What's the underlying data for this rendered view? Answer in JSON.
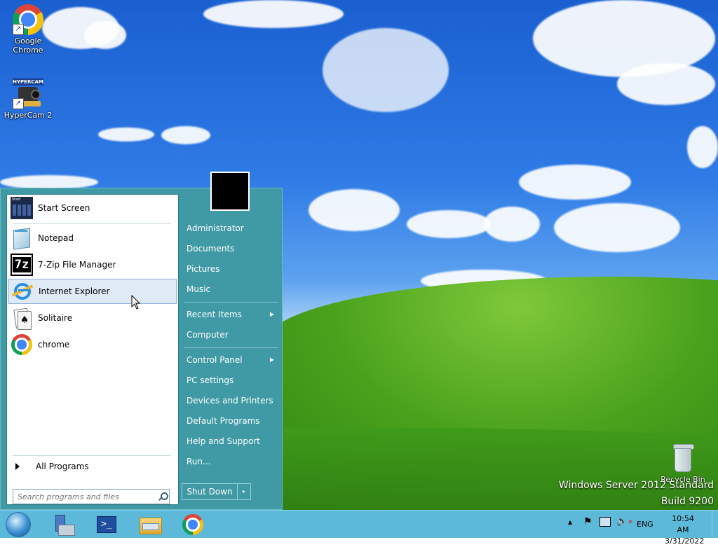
{
  "desktop": {
    "icons": [
      {
        "label": "Google Chrome",
        "icon": "chrome-icon"
      },
      {
        "label": "HyperCam 2",
        "icon": "hypercam-icon"
      },
      {
        "label": "Recycle Bin",
        "icon": "recycle-bin-icon"
      }
    ],
    "watermark": {
      "line1": "Windows Server 2012 Standard",
      "line2": "Build 9200"
    },
    "hypercam_logo_text": "HYPERCAM"
  },
  "start_menu": {
    "pinned": [
      {
        "label": "Start Screen",
        "icon": "start-screen-icon"
      }
    ],
    "recent": [
      {
        "label": "Notepad",
        "icon": "notepad-icon"
      },
      {
        "label": "7-Zip File Manager",
        "icon": "sevenzip-icon"
      },
      {
        "label": "Internet Explorer",
        "icon": "ie-icon",
        "hover": true
      },
      {
        "label": "Solitaire",
        "icon": "solitaire-icon"
      },
      {
        "label": "chrome",
        "icon": "chrome-icon"
      }
    ],
    "all_programs": "All Programs",
    "search": {
      "placeholder": "Search programs and files",
      "value": ""
    },
    "right": [
      {
        "label": "Administrator"
      },
      {
        "label": "Documents"
      },
      {
        "label": "Pictures"
      },
      {
        "label": "Music"
      },
      {
        "label": "Recent Items",
        "submenu": true
      },
      {
        "label": "Computer"
      },
      {
        "label": "Control Panel",
        "submenu": true
      },
      {
        "label": "PC settings"
      },
      {
        "label": "Devices and Printers"
      },
      {
        "label": "Default Programs"
      },
      {
        "label": "Help and Support"
      },
      {
        "label": "Run..."
      }
    ],
    "shutdown": {
      "label": "Shut Down",
      "arrow": "▸"
    },
    "sevenzip_text": "7z",
    "start_screen_text": "Start"
  },
  "taskbar": {
    "apps": [
      {
        "icon": "start-orb-icon"
      },
      {
        "icon": "server-manager-icon"
      },
      {
        "icon": "powershell-icon"
      },
      {
        "icon": "file-explorer-icon"
      },
      {
        "icon": "chrome-icon"
      }
    ],
    "tray": {
      "language": "ENG",
      "time": "10:54 AM",
      "date": "3/31/2022",
      "overflow": "▲"
    }
  },
  "colors": {
    "start_menu_bg": "#3f9aa6",
    "taskbar_bg": "#5db9d9",
    "hover_bg": "#dfeaf5"
  }
}
